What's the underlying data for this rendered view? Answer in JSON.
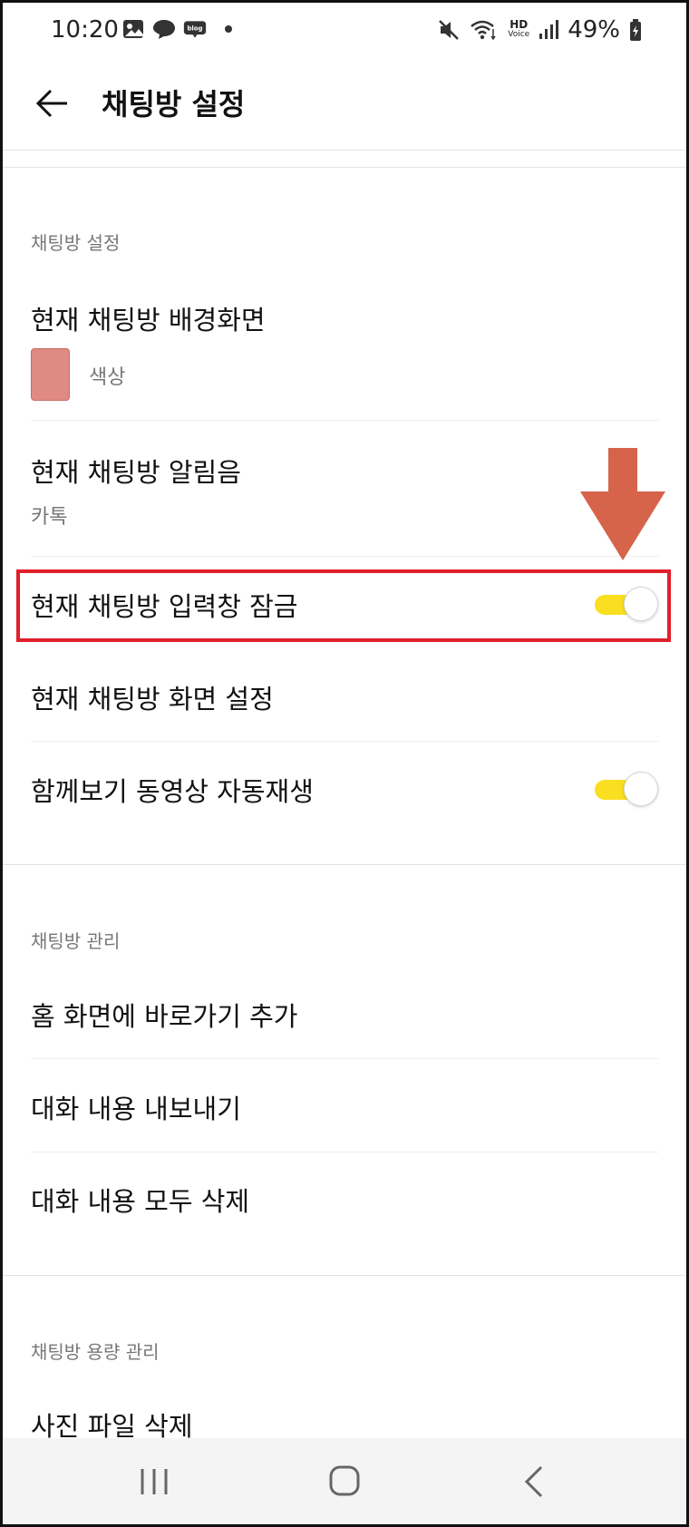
{
  "status_bar": {
    "time": "10:20",
    "battery": "49%",
    "left_icons": [
      "gallery-icon",
      "chat-bubble-icon",
      "blog-icon",
      "dot"
    ],
    "right_icons": [
      "mute-icon",
      "wifi-icon",
      "hd-voice-icon",
      "signal-icon",
      "battery-icon"
    ],
    "hd_line1": "HD",
    "hd_line2": "Voice"
  },
  "header": {
    "title": "채팅방 설정"
  },
  "sections": {
    "chatroom_settings": {
      "label": "채팅방 설정",
      "background": {
        "title": "현재 채팅방 배경화면",
        "value": "색상",
        "color": "#df8a82"
      },
      "notification": {
        "title": "현재 채팅방 알림음",
        "value": "카톡"
      },
      "input_lock": {
        "title": "현재 채팅방 입력창 잠금",
        "enabled": true
      },
      "screen_settings": {
        "title": "현재 채팅방 화면 설정"
      },
      "autoplay": {
        "title": "함께보기 동영상 자동재생",
        "enabled": true
      }
    },
    "chatroom_management": {
      "label": "채팅방 관리",
      "shortcut": {
        "title": "홈 화면에 바로가기 추가"
      },
      "export": {
        "title": "대화 내용 내보내기"
      },
      "delete_all": {
        "title": "대화 내용 모두 삭제"
      }
    },
    "storage_management": {
      "label": "채팅방 용량 관리",
      "delete_photos": {
        "title": "사진 파일 삭제"
      }
    }
  },
  "colors": {
    "toggle_on": "#f9df1f",
    "highlight_border": "#e0202c",
    "arrow": "#d6644a"
  },
  "navbar": {
    "icons": [
      "recent-apps-icon",
      "home-icon",
      "back-icon"
    ]
  }
}
